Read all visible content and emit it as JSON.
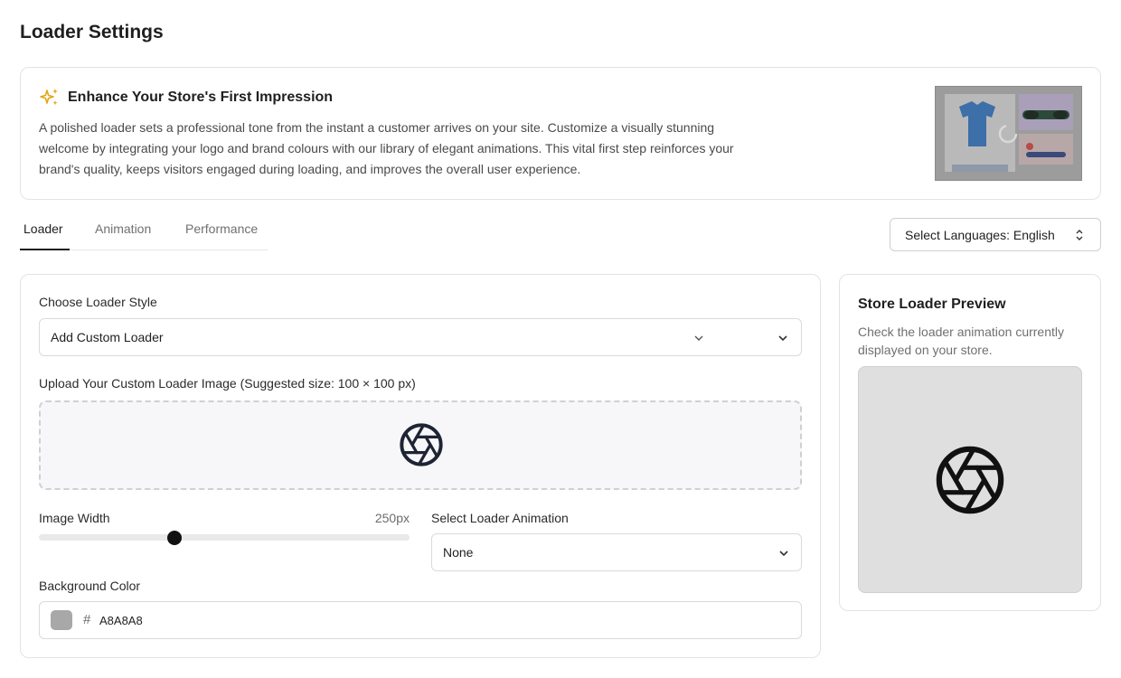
{
  "page": {
    "title": "Loader Settings"
  },
  "banner": {
    "icon": "sparkles-icon",
    "title": "Enhance Your Store's First Impression",
    "description": "A polished loader sets a professional tone from the instant a customer arrives on your site. Customize a visually stunning welcome by integrating your logo and brand colours with our library of elegant animations. This vital first step reinforces your brand's quality, keeps visitors engaged during loading, and improves the overall user experience.",
    "accent_color": "#E8A317"
  },
  "tabs": [
    {
      "label": "Loader",
      "active": true
    },
    {
      "label": "Animation",
      "active": false
    },
    {
      "label": "Performance",
      "active": false
    }
  ],
  "language_select": {
    "label": "Select Languages: English",
    "icon": "up-down-arrows-icon"
  },
  "loader_form": {
    "style_label": "Choose Loader Style",
    "style_value": "Add Custom Loader",
    "upload_label": "Upload Your Custom Loader Image (Suggested size: 100 × 100 px)",
    "upload_icon": "camera-aperture-icon",
    "width_label": "Image Width",
    "width_value": "250px",
    "width_fraction": 0.366,
    "animation_label": "Select Loader Animation",
    "animation_value": "None",
    "bg_label": "Background Color",
    "bg_hash": "#",
    "bg_hex": "A8A8A8",
    "bg_color": "#A8A8A8"
  },
  "preview": {
    "title": "Store Loader Preview",
    "description": "Check the loader animation currently displayed on your store.",
    "bg_color": "#DFDFDF",
    "icon": "camera-aperture-icon"
  }
}
